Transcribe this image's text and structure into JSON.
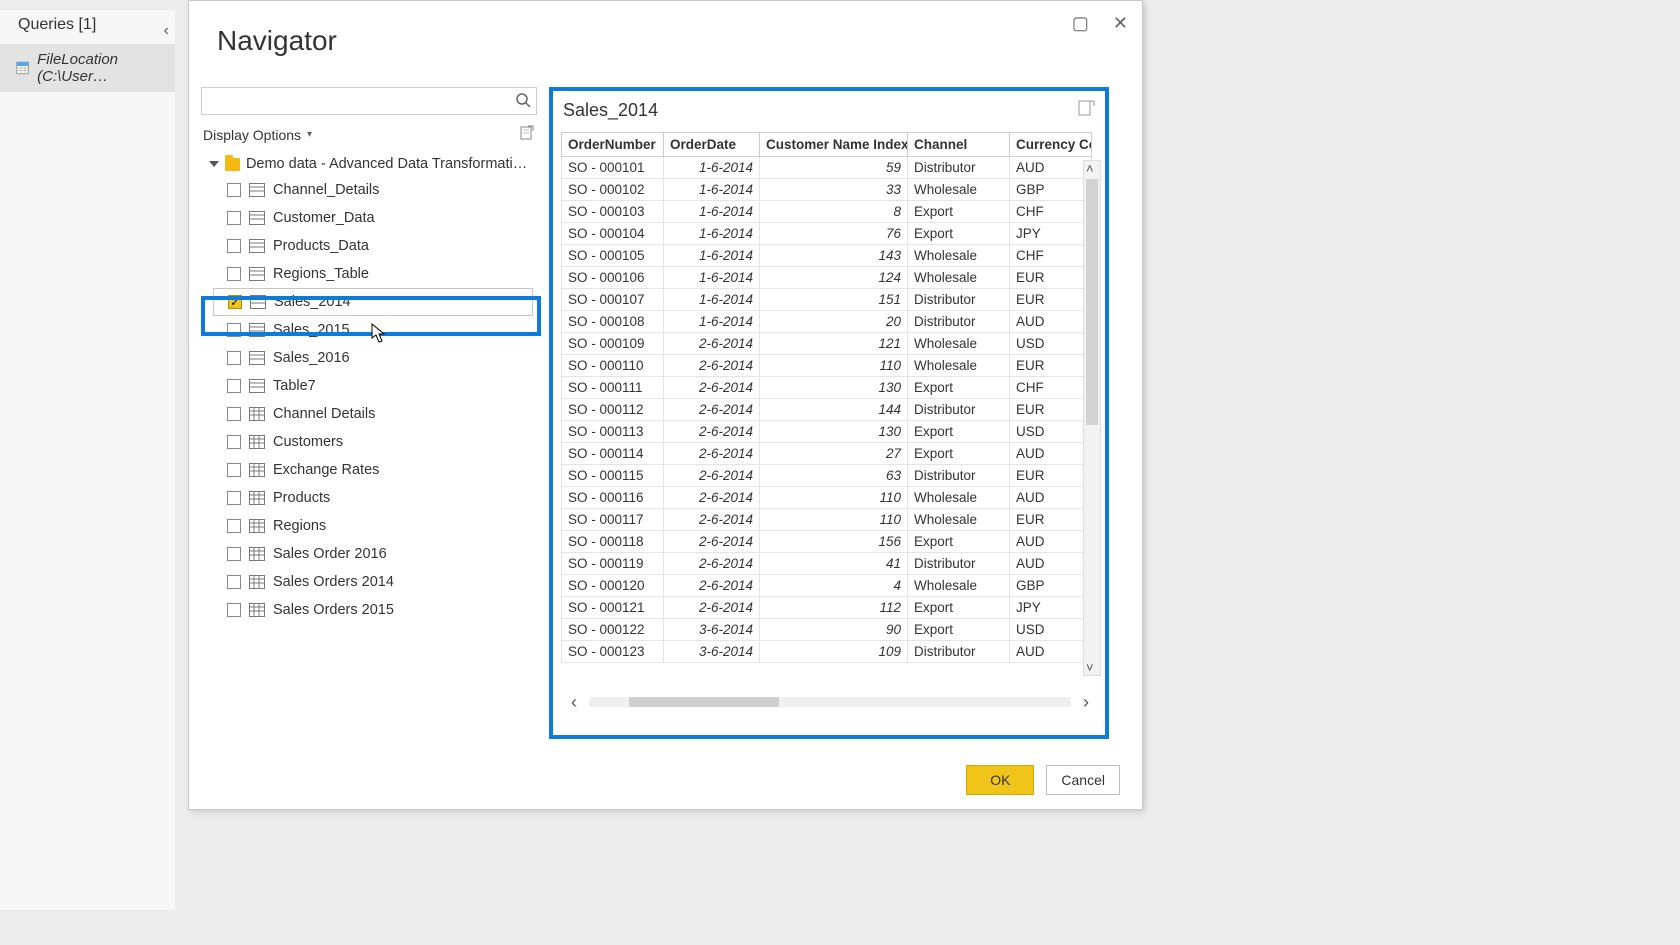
{
  "queries_panel": {
    "title": "Queries [1]",
    "item_label": "FileLocation (C:\\User…"
  },
  "dialog": {
    "title": "Navigator",
    "search_placeholder": "",
    "display_options": "Display Options",
    "root_label": "Demo data - Advanced Data Transformation a…",
    "tree_items": [
      {
        "label": "Channel_Details",
        "checked": false,
        "kind": "sheet"
      },
      {
        "label": "Customer_Data",
        "checked": false,
        "kind": "sheet"
      },
      {
        "label": "Products_Data",
        "checked": false,
        "kind": "sheet"
      },
      {
        "label": "Regions_Table",
        "checked": false,
        "kind": "sheet"
      },
      {
        "label": "Sales_2014",
        "checked": true,
        "kind": "sheet",
        "selected": true
      },
      {
        "label": "Sales_2015",
        "checked": false,
        "kind": "sheet"
      },
      {
        "label": "Sales_2016",
        "checked": false,
        "kind": "sheet"
      },
      {
        "label": "Table7",
        "checked": false,
        "kind": "sheet"
      },
      {
        "label": "Channel Details",
        "checked": false,
        "kind": "table"
      },
      {
        "label": "Customers",
        "checked": false,
        "kind": "table"
      },
      {
        "label": "Exchange Rates",
        "checked": false,
        "kind": "table"
      },
      {
        "label": "Products",
        "checked": false,
        "kind": "table"
      },
      {
        "label": "Regions",
        "checked": false,
        "kind": "table"
      },
      {
        "label": "Sales Order 2016",
        "checked": false,
        "kind": "table"
      },
      {
        "label": "Sales Orders 2014",
        "checked": false,
        "kind": "table"
      },
      {
        "label": "Sales Orders 2015",
        "checked": false,
        "kind": "table"
      }
    ],
    "preview": {
      "title": "Sales_2014",
      "columns": [
        "OrderNumber",
        "OrderDate",
        "Customer Name Index",
        "Channel",
        "Currency Code"
      ],
      "rows": [
        [
          "SO - 000101",
          "1-6-2014",
          "59",
          "Distributor",
          "AUD"
        ],
        [
          "SO - 000102",
          "1-6-2014",
          "33",
          "Wholesale",
          "GBP"
        ],
        [
          "SO - 000103",
          "1-6-2014",
          "8",
          "Export",
          "CHF"
        ],
        [
          "SO - 000104",
          "1-6-2014",
          "76",
          "Export",
          "JPY"
        ],
        [
          "SO - 000105",
          "1-6-2014",
          "143",
          "Wholesale",
          "CHF"
        ],
        [
          "SO - 000106",
          "1-6-2014",
          "124",
          "Wholesale",
          "EUR"
        ],
        [
          "SO - 000107",
          "1-6-2014",
          "151",
          "Distributor",
          "EUR"
        ],
        [
          "SO - 000108",
          "1-6-2014",
          "20",
          "Distributor",
          "AUD"
        ],
        [
          "SO - 000109",
          "2-6-2014",
          "121",
          "Wholesale",
          "USD"
        ],
        [
          "SO - 000110",
          "2-6-2014",
          "110",
          "Wholesale",
          "EUR"
        ],
        [
          "SO - 000111",
          "2-6-2014",
          "130",
          "Export",
          "CHF"
        ],
        [
          "SO - 000112",
          "2-6-2014",
          "144",
          "Distributor",
          "EUR"
        ],
        [
          "SO - 000113",
          "2-6-2014",
          "130",
          "Export",
          "USD"
        ],
        [
          "SO - 000114",
          "2-6-2014",
          "27",
          "Export",
          "AUD"
        ],
        [
          "SO - 000115",
          "2-6-2014",
          "63",
          "Distributor",
          "EUR"
        ],
        [
          "SO - 000116",
          "2-6-2014",
          "110",
          "Wholesale",
          "AUD"
        ],
        [
          "SO - 000117",
          "2-6-2014",
          "110",
          "Wholesale",
          "EUR"
        ],
        [
          "SO - 000118",
          "2-6-2014",
          "156",
          "Export",
          "AUD"
        ],
        [
          "SO - 000119",
          "2-6-2014",
          "41",
          "Distributor",
          "AUD"
        ],
        [
          "SO - 000120",
          "2-6-2014",
          "4",
          "Wholesale",
          "GBP"
        ],
        [
          "SO - 000121",
          "2-6-2014",
          "112",
          "Export",
          "JPY"
        ],
        [
          "SO - 000122",
          "3-6-2014",
          "90",
          "Export",
          "USD"
        ],
        [
          "SO - 000123",
          "3-6-2014",
          "109",
          "Distributor",
          "AUD"
        ]
      ]
    },
    "buttons": {
      "ok": "OK",
      "cancel": "Cancel"
    }
  }
}
